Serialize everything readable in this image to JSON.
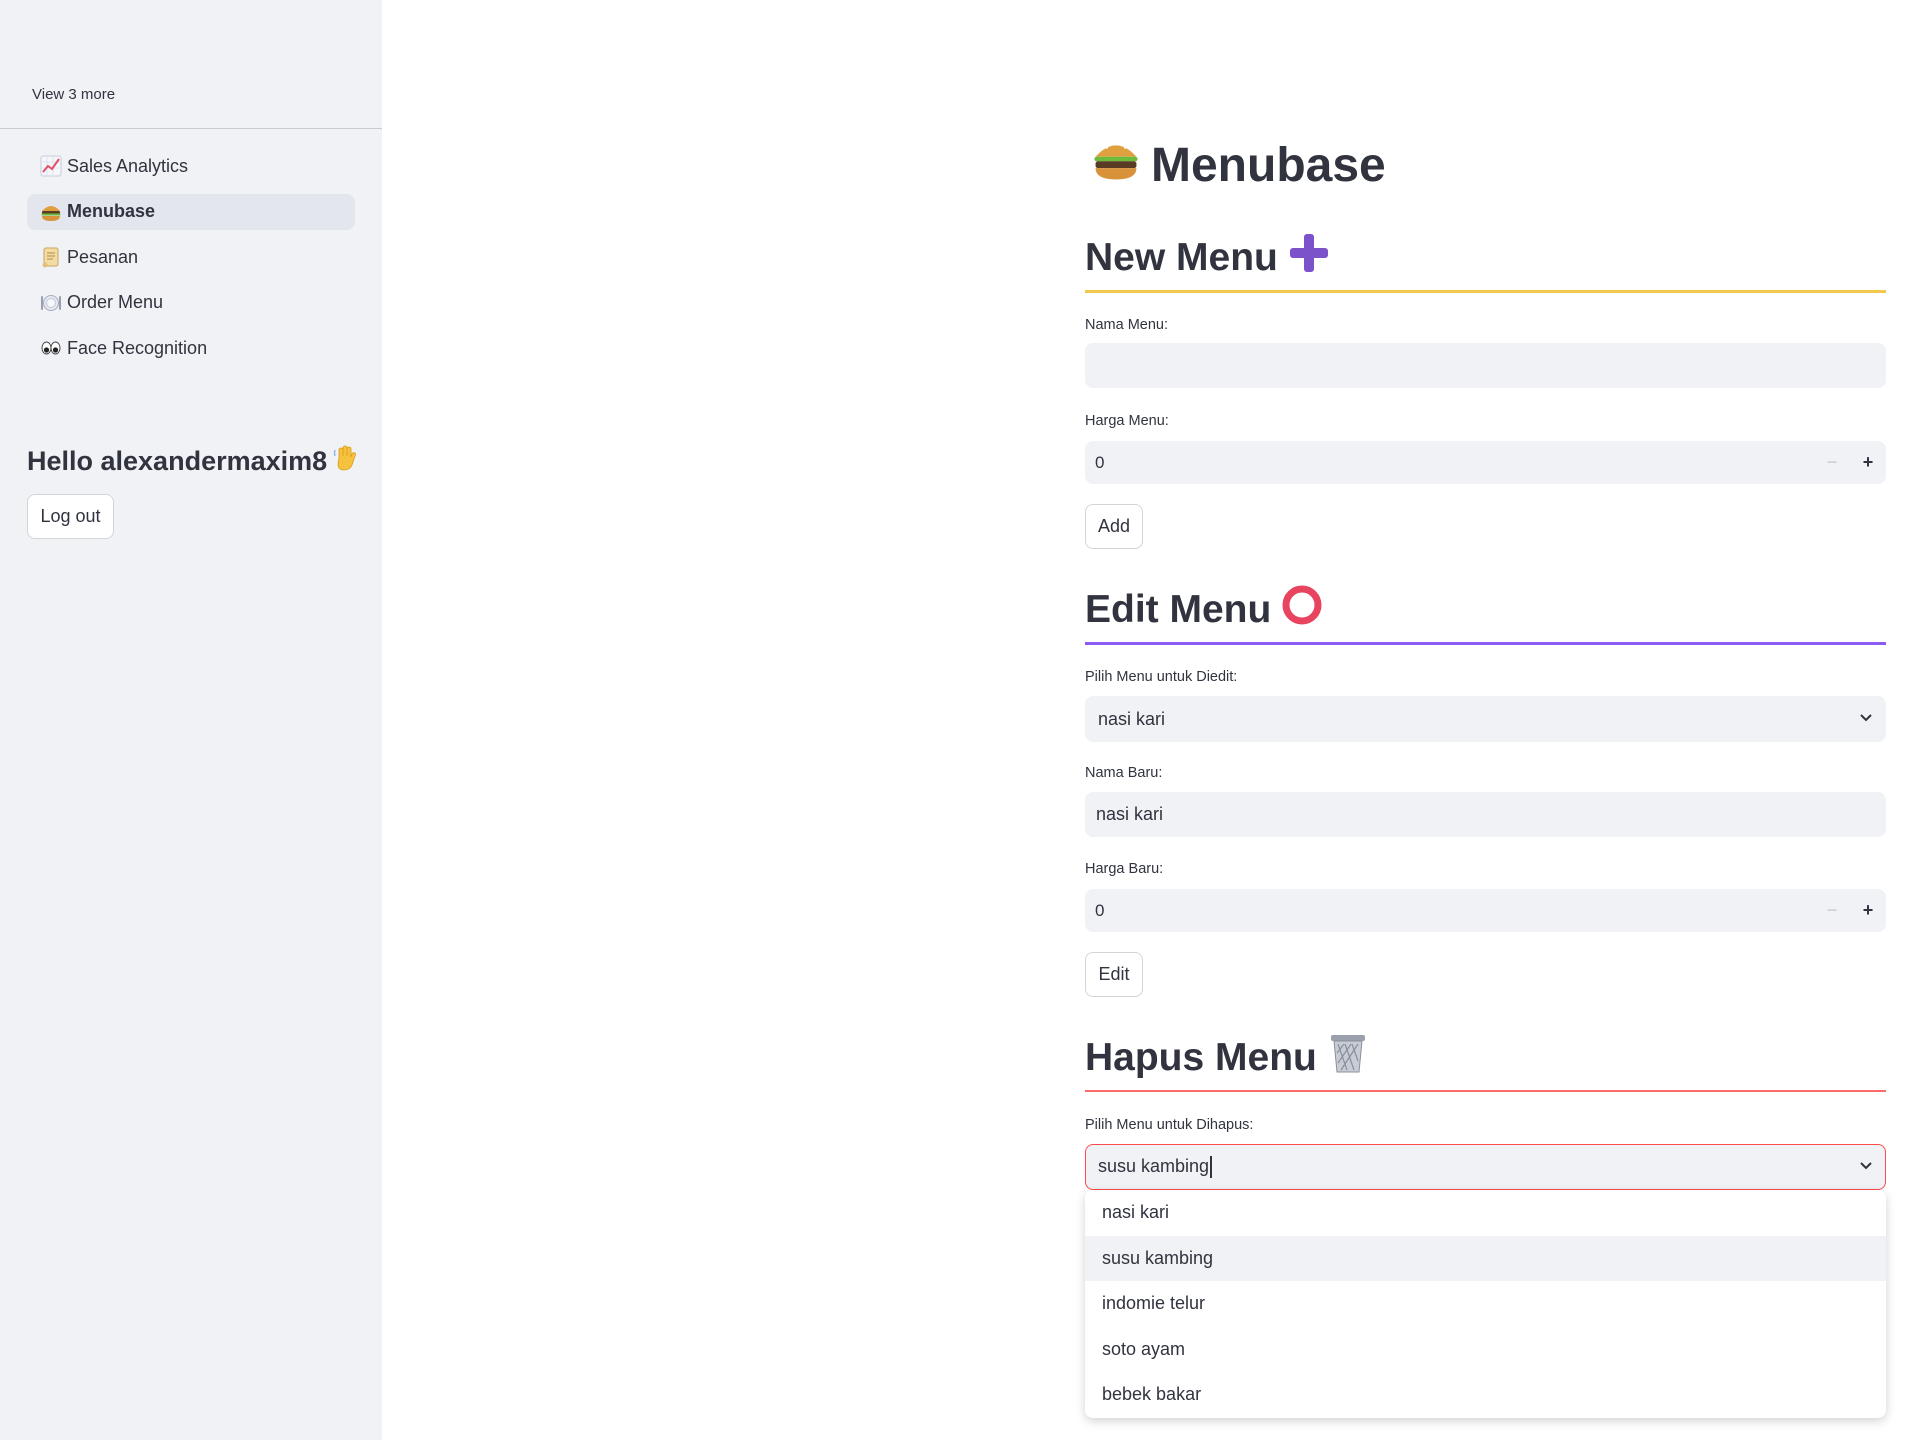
{
  "sidebar": {
    "view_more": "View 3 more",
    "nav": [
      {
        "label": "Sales Analytics",
        "icon": "chart-increasing-icon",
        "active": false
      },
      {
        "label": "Menubase",
        "icon": "burger-icon",
        "active": true
      },
      {
        "label": "Pesanan",
        "icon": "scroll-icon",
        "active": false
      },
      {
        "label": "Order Menu",
        "icon": "plate-icon",
        "active": false
      },
      {
        "label": "Face Recognition",
        "icon": "eyes-icon",
        "active": false
      }
    ],
    "greeting": "Hello alexandermaxim8",
    "greeting_icon": "waving-hand-icon",
    "logout_label": "Log out"
  },
  "page": {
    "title": "Menubase",
    "title_icon": "burger-icon"
  },
  "new_menu": {
    "heading": "New Menu",
    "heading_icon": "plus-icon",
    "rule_color": "#f0c94a",
    "name_label": "Nama Menu:",
    "name_value": "",
    "price_label": "Harga Menu:",
    "price_value": "0",
    "add_label": "Add"
  },
  "edit_menu": {
    "heading": "Edit Menu",
    "heading_icon": "hollow-red-circle-icon",
    "rule_color": "#8a5cf5",
    "select_label": "Pilih Menu untuk Diedit:",
    "select_value": "nasi kari",
    "new_name_label": "Nama Baru:",
    "new_name_value": "nasi kari",
    "new_price_label": "Harga Baru:",
    "new_price_value": "0",
    "edit_label": "Edit"
  },
  "delete_menu": {
    "heading": "Hapus Menu",
    "heading_icon": "wastebasket-icon",
    "rule_color": "#ff6b6b",
    "select_label": "Pilih Menu untuk Dihapus:",
    "select_value": "susu kambing",
    "options": [
      "nasi kari",
      "susu kambing",
      "indomie telur",
      "soto ayam",
      "bebek bakar"
    ],
    "hovered_option": "susu kambing"
  },
  "colors": {
    "sidebar_bg": "#f0f2f6",
    "input_bg": "#f0f2f6",
    "focus_border": "#ff4b4b",
    "text": "#31333f"
  }
}
